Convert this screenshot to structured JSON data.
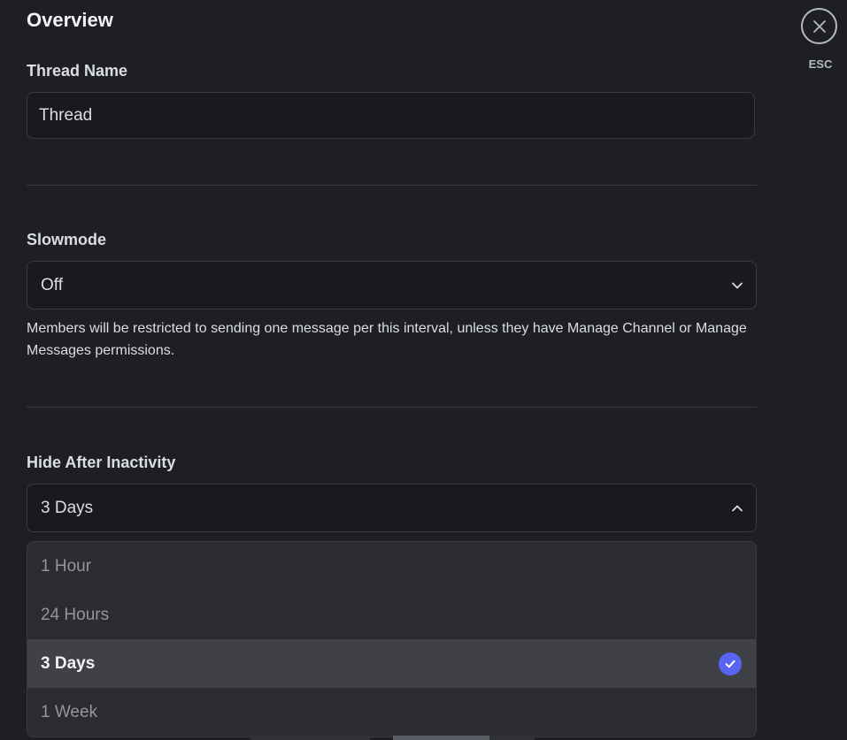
{
  "page": {
    "title": "Overview"
  },
  "close": {
    "esc_label": "ESC",
    "icon": "close-icon"
  },
  "thread_name": {
    "label": "Thread Name",
    "value": "Thread"
  },
  "slowmode": {
    "label": "Slowmode",
    "selected": "Off",
    "help": "Members will be restricted to sending one message per this interval, unless they have Manage Channel or Manage Messages permissions."
  },
  "hide_after_inactivity": {
    "label": "Hide After Inactivity",
    "selected": "3 Days",
    "options": [
      {
        "label": "1 Hour",
        "selected": false
      },
      {
        "label": "24 Hours",
        "selected": false
      },
      {
        "label": "3 Days",
        "selected": true
      },
      {
        "label": "1 Week",
        "selected": false
      }
    ]
  },
  "colors": {
    "background": "#1e1f22",
    "accent": "#5865f2",
    "input_bg": "#1a1a1e",
    "dropdown_bg": "#2b2b30",
    "selected_bg": "#404147"
  }
}
